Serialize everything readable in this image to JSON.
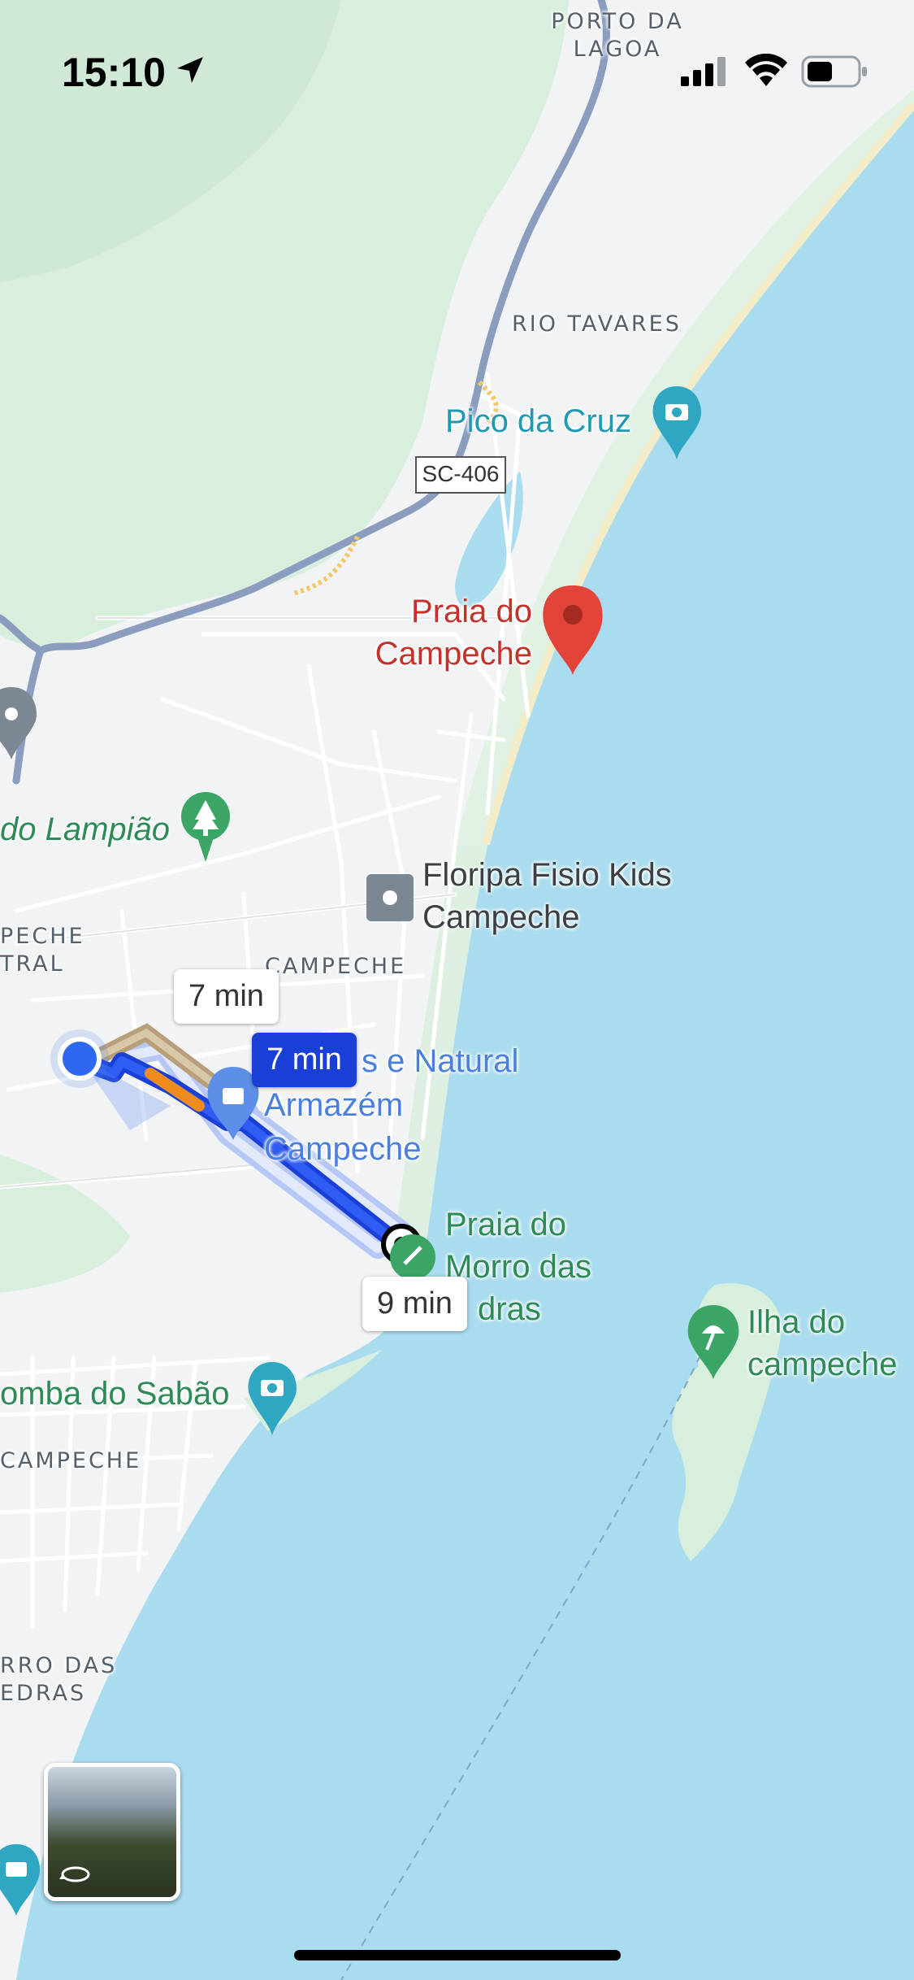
{
  "status_bar": {
    "time": "15:10",
    "location_icon": "location-arrow-icon",
    "signal_icon": "cellular-signal-icon",
    "wifi_icon": "wifi-icon",
    "battery_icon": "battery-icon"
  },
  "areas": {
    "porto_da_lagoa_1": "PORTO DA",
    "porto_da_lagoa_2": "LAGOA",
    "rio_tavares": "RIO TAVARES",
    "campeche": "CAMPECHE",
    "campeche_central_1": "PECHE",
    "campeche_central_2": "TRAL",
    "campeche_south": "CAMPECHE",
    "morro_1": "RRO DAS",
    "morro_2": "EDRAS"
  },
  "road_shield": "SC-406",
  "pois": {
    "pico_da_cruz": "Pico da Cruz",
    "praia_campeche_1": "Praia do",
    "praia_campeche_2": "Campeche",
    "lampiao": "do Lampião",
    "fisio_1": "Floripa Fisio Kids",
    "fisio_2": "Campeche",
    "armazem_1": "s e Natural",
    "armazem_2": "Armazém",
    "armazem_3": "Campeche",
    "praia_morro_1": "Praia do",
    "praia_morro_2": "Morro das",
    "praia_morro_3": "dras",
    "ilha_1": "Ilha do",
    "ilha_2": "campeche",
    "lomba": "omba do Sabão"
  },
  "route_bubbles": {
    "alt1": "7 min",
    "selected": "7 min",
    "alt2": "9 min"
  },
  "colors": {
    "water": "#a9dcee",
    "land": "#f1f3f4",
    "park": "#d8efdd",
    "route_selected": "#1a3fd6",
    "route_alt": "#b6c6f5",
    "traffic": "#f08c1e",
    "pin": "#e2443a"
  },
  "street_view_icon": "street-view-rotate-icon"
}
